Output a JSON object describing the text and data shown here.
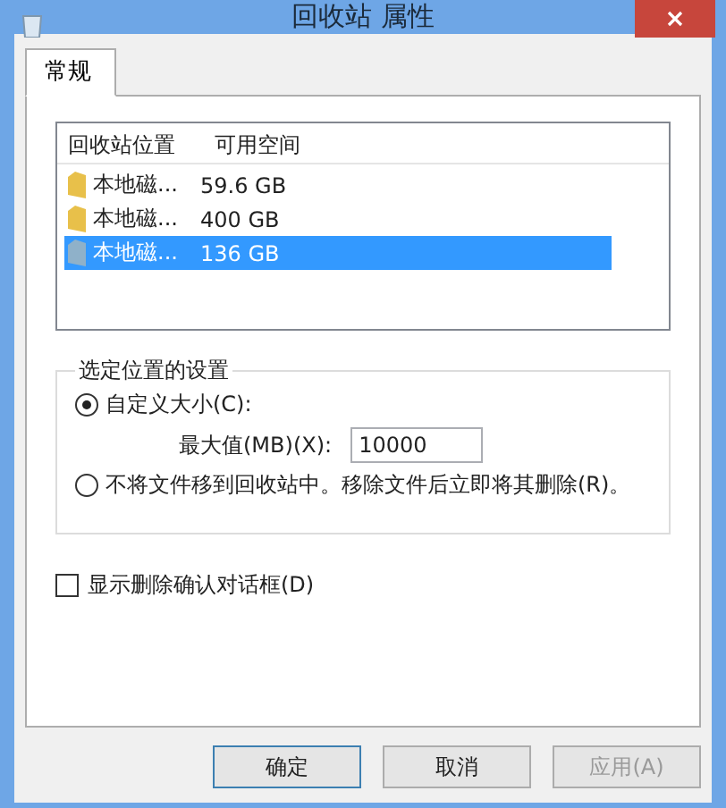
{
  "window": {
    "title": "回收站 属性"
  },
  "tabs": [
    {
      "label": "常规",
      "selected": true
    }
  ],
  "list": {
    "columns": [
      "回收站位置",
      "可用空间"
    ],
    "rows": [
      {
        "location": "本地磁...",
        "space": "59.6 GB",
        "selected": false,
        "kind": "folder"
      },
      {
        "location": "本地磁...",
        "space": "400 GB",
        "selected": false,
        "kind": "folder"
      },
      {
        "location": "本地磁...",
        "space": "136 GB",
        "selected": true,
        "kind": "drive"
      }
    ]
  },
  "settings": {
    "title": "选定位置的设置",
    "options": [
      {
        "label": "自定义大小(C):",
        "selected": true
      },
      {
        "label": "不将文件移到回收站中。移除文件后立即将其删除(R)。",
        "selected": false
      }
    ],
    "max_size": {
      "label": "最大值(MB)(X):",
      "value": "10000"
    }
  },
  "confirm": {
    "label": "显示删除确认对话框(D)",
    "checked": false
  },
  "buttons": [
    {
      "label": "确定",
      "disabled": false,
      "default": true
    },
    {
      "label": "取消",
      "disabled": false,
      "default": false
    },
    {
      "label": "应用(A)",
      "disabled": true,
      "default": false
    }
  ]
}
